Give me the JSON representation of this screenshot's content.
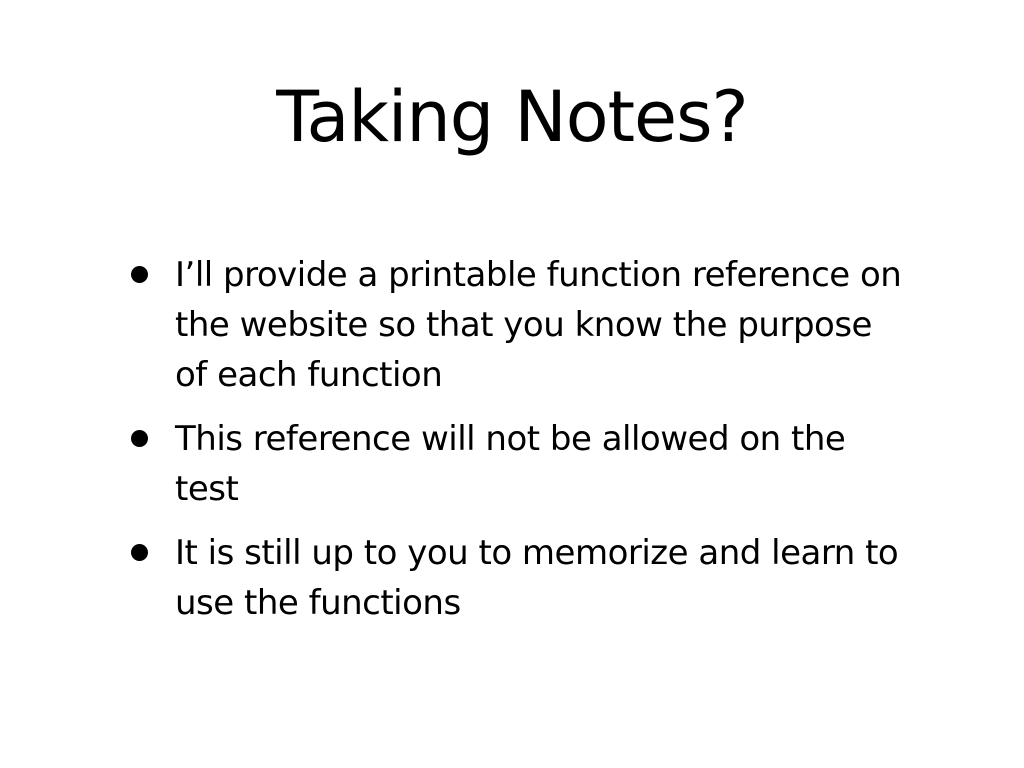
{
  "slide": {
    "title": "Taking Notes?",
    "bullets": [
      "I’ll provide a printable function reference on the website so that you know the purpose of each function",
      "This reference will not be allowed on the test",
      "It is still up to you to memorize and learn to use the functions"
    ]
  }
}
